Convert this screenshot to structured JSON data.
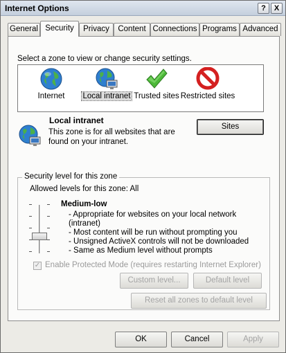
{
  "window": {
    "title": "Internet Options",
    "help_label": "?",
    "close_label": "X"
  },
  "tabs": [
    {
      "label": "General"
    },
    {
      "label": "Security",
      "active": true
    },
    {
      "label": "Privacy"
    },
    {
      "label": "Content"
    },
    {
      "label": "Connections"
    },
    {
      "label": "Programs"
    },
    {
      "label": "Advanced"
    }
  ],
  "security": {
    "prompt": "Select a zone to view or change security settings.",
    "zones": [
      {
        "label": "Internet",
        "icon": "globe-icon"
      },
      {
        "label": "Local intranet",
        "icon": "local-intranet-icon",
        "selected": true
      },
      {
        "label": "Trusted sites",
        "icon": "checkmark-icon"
      },
      {
        "label": "Restricted sites",
        "icon": "restricted-icon"
      }
    ],
    "selected_zone": {
      "name": "Local intranet",
      "description": "This zone is for all websites that are found on your intranet.",
      "sites_button": "Sites"
    },
    "level_group": {
      "title": "Security level for this zone",
      "allowed_levels": "Allowed levels for this zone: All",
      "level_name": "Medium-low",
      "bullets": [
        "- Appropriate for websites on your local network",
        "(intranet)",
        "- Most content will be run without prompting you",
        "- Unsigned ActiveX controls will not be downloaded",
        "- Same as Medium level without prompts"
      ],
      "protected_mode_label": "Enable Protected Mode (requires restarting Internet Explorer)",
      "protected_mode_checked": true,
      "custom_level_button": "Custom level...",
      "default_level_button": "Default level"
    },
    "reset_all_button": "Reset all zones to default level"
  },
  "footer": {
    "ok": "OK",
    "cancel": "Cancel",
    "apply": "Apply"
  }
}
